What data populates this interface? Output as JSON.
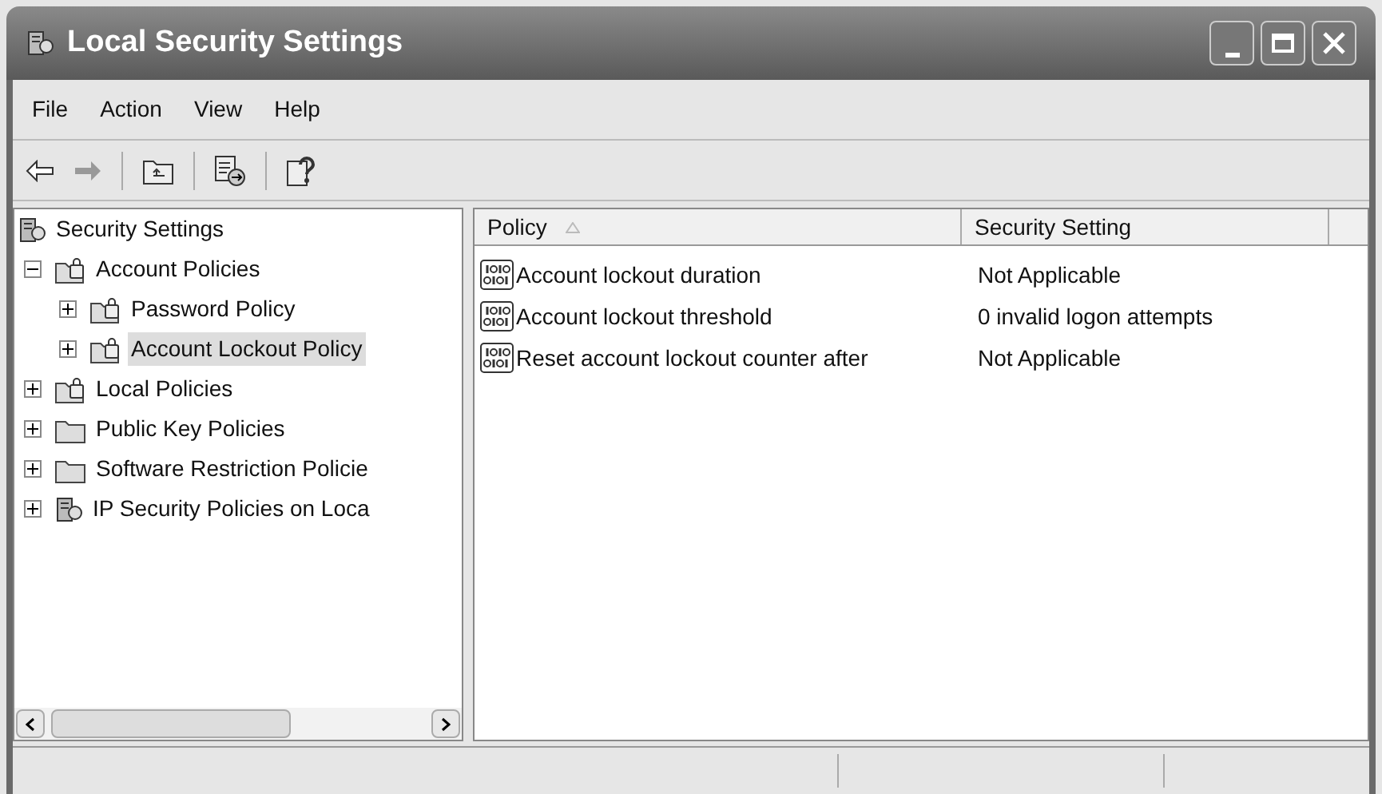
{
  "window": {
    "title": "Local Security Settings"
  },
  "menu": [
    "File",
    "Action",
    "View",
    "Help"
  ],
  "tree": [
    {
      "label": "Security Settings",
      "kind": "server",
      "selected": false,
      "children": [
        {
          "label": "Account Policies",
          "kind": "lockfolder",
          "selected": false,
          "expanded": true,
          "children": [
            {
              "label": "Password Policy",
              "kind": "lockfolder",
              "selected": false,
              "expanded": false
            },
            {
              "label": "Account Lockout Policy",
              "kind": "lockfolder",
              "selected": true,
              "expanded": false
            }
          ]
        },
        {
          "label": "Local Policies",
          "kind": "lockfolder",
          "selected": false,
          "expanded": false
        },
        {
          "label": "Public Key Policies",
          "kind": "folder",
          "selected": false,
          "expanded": false
        },
        {
          "label": "Software Restriction Policie",
          "kind": "folder",
          "selected": false,
          "expanded": false
        },
        {
          "label": "IP Security Policies on Loca",
          "kind": "server",
          "selected": false,
          "expanded": false
        }
      ]
    }
  ],
  "table": {
    "columns": [
      "Policy",
      "Security Setting"
    ],
    "rows": [
      {
        "policy": "Account lockout duration",
        "setting": "Not Applicable"
      },
      {
        "policy": "Account lockout threshold",
        "setting": "0 invalid logon attempts"
      },
      {
        "policy": "Reset account lockout counter after",
        "setting": "Not Applicable"
      }
    ]
  }
}
